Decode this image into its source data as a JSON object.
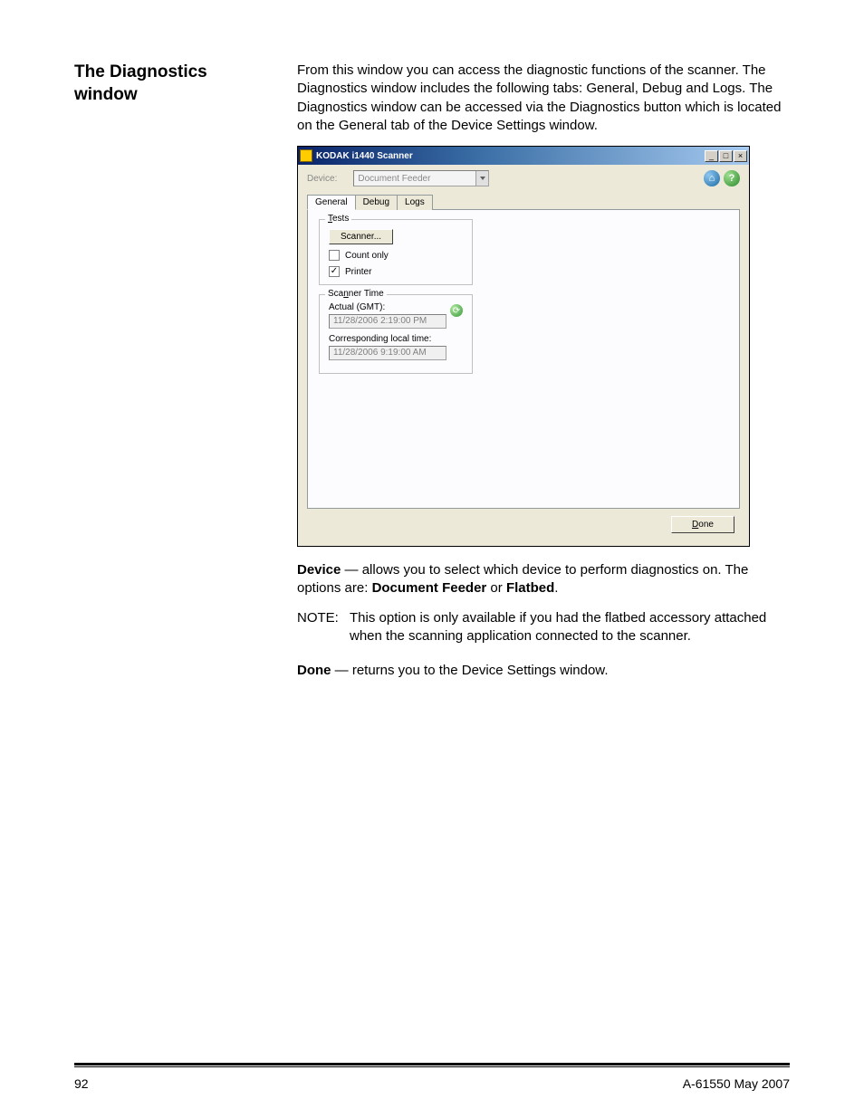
{
  "heading": "The Diagnostics window",
  "intro": "From this window you can access the diagnostic functions of the scanner. The Diagnostics window includes the following tabs: General, Debug and Logs. The Diagnostics window can be accessed via the Diagnostics button which is located on the General tab of the Device Settings window.",
  "win": {
    "title": "KODAK i1440 Scanner",
    "device_label": "Device:",
    "device_value": "Document Feeder",
    "tabs": {
      "general": "General",
      "debug": "Debug",
      "logs": "Logs"
    },
    "tests_group": "Tests",
    "tests_t_underline": "T",
    "scanner_btn": "Scanner...",
    "count_only": "Count only",
    "printer": "Printer",
    "scanner_time_group": "Scanner Time",
    "scanner_time_n_underline": "n",
    "actual_label": "Actual (GMT):",
    "actual_value": "11/28/2006 2:19:00 PM",
    "local_label": "Corresponding local time:",
    "local_value": "11/28/2006 9:19:00 AM",
    "done": "Done",
    "done_underline": "D"
  },
  "device_para_bold": "Device",
  "device_para_rest": " — allows you to select which device to perform diagnostics on. The options are: ",
  "device_opt1": "Document Feeder",
  "device_or": " or ",
  "device_opt2": "Flatbed",
  "device_period": ".",
  "note_label": "NOTE:",
  "note_text": "This option is only available if you had the flatbed accessory attached when the scanning application connected to the scanner.",
  "done_bold": "Done",
  "done_rest": " — returns you to the Device Settings window.",
  "footer": {
    "page": "92",
    "doc": "A-61550  May 2007"
  }
}
